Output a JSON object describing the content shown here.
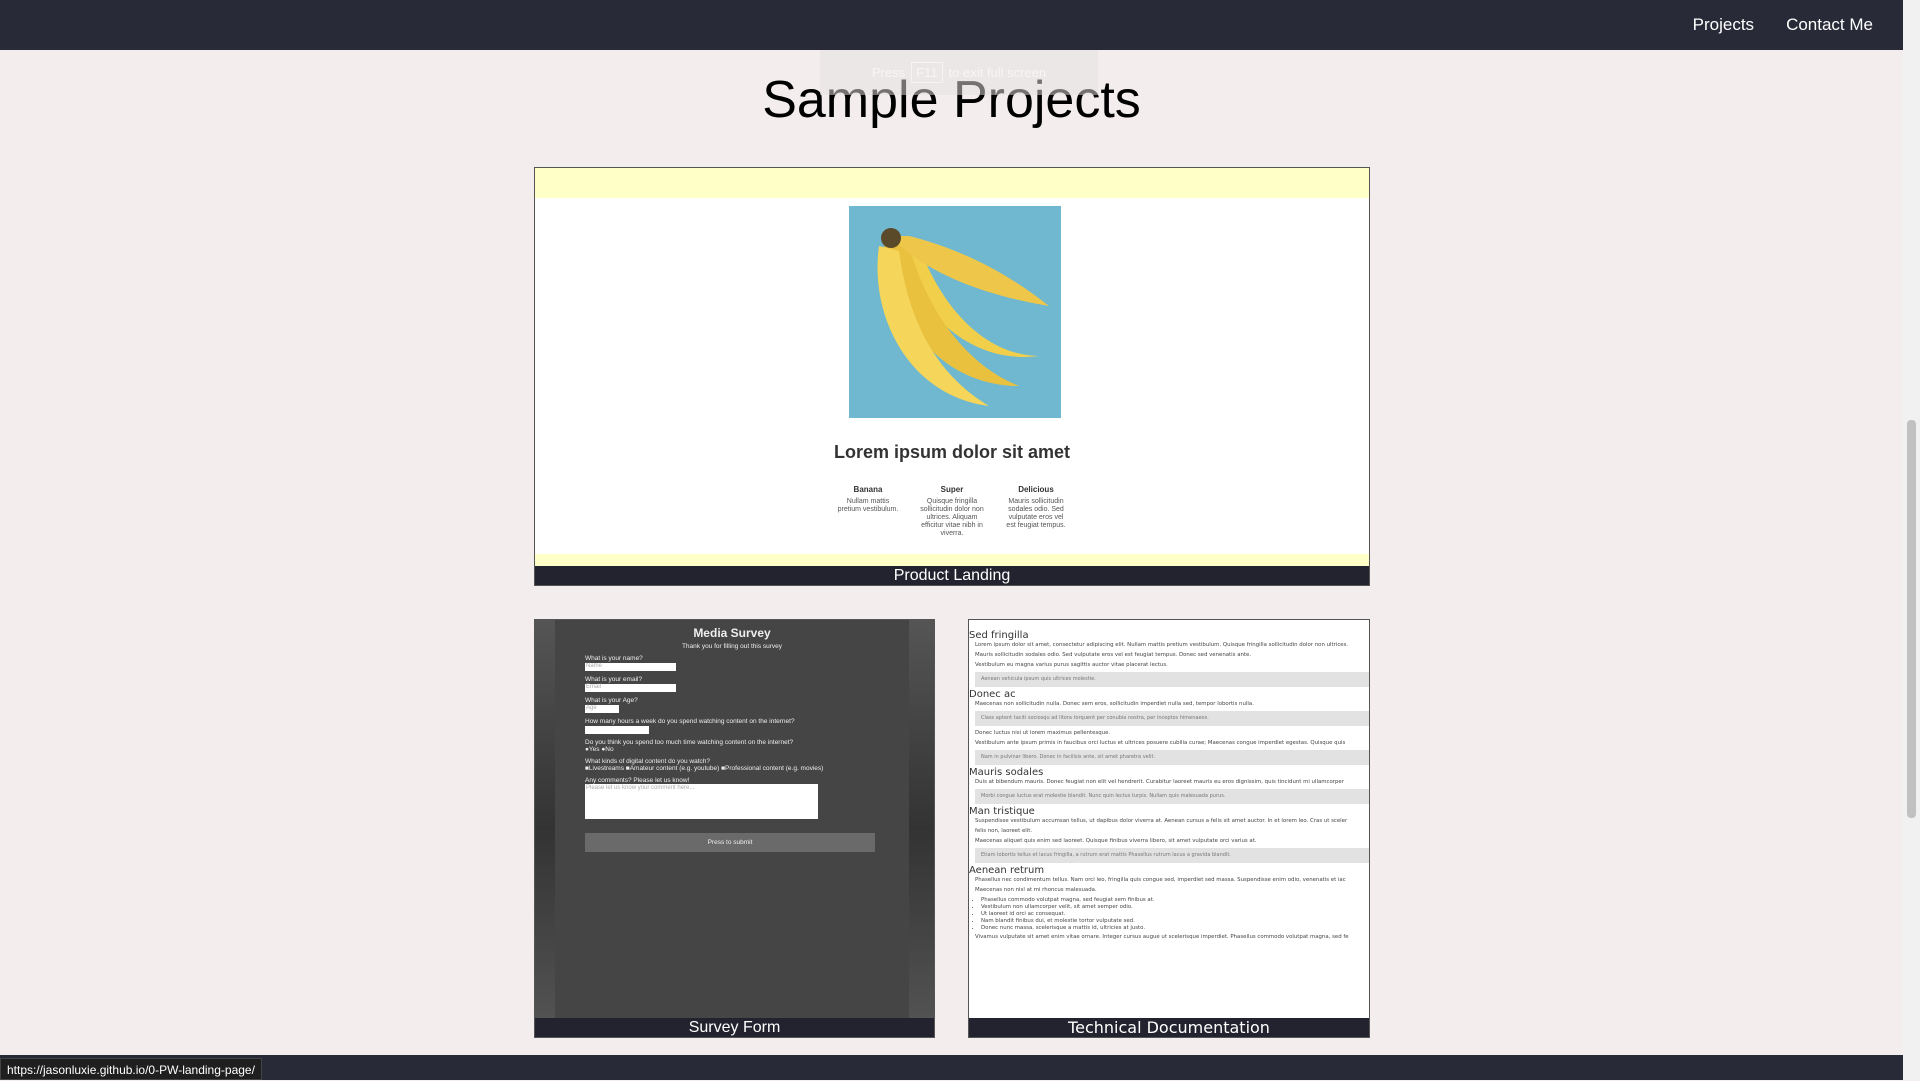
{
  "nav": {
    "links": [
      "Projects",
      "Contact Me"
    ]
  },
  "toast": {
    "pre": "Press",
    "key": "F11",
    "post": "to exit full screen"
  },
  "title": "Sample Projects",
  "product": {
    "heading": "Lorem ipsum dolor sit amet",
    "features": [
      {
        "title": "Banana",
        "text": "Nullam mattis pretium vestibulum."
      },
      {
        "title": "Super",
        "text": "Quisque fringilla sollicitudin dolor non ultrices. Aliquam efficitur vitae nibh in viverra."
      },
      {
        "title": "Delicious",
        "text": "Mauris sollicitudin sodales odio. Sed vulputate eros vel est feugiat tempus."
      }
    ],
    "caption": "Product Landing"
  },
  "survey": {
    "title": "Media Survey",
    "subtitle": "Thank you for filling out this survey",
    "q1": "What is your name?",
    "p1": "Name",
    "q2": "What is your email?",
    "p2": "Email",
    "q3": "What is your Age?",
    "p3": "Age",
    "q4": "How many hours a week do you spend watching content on the internet?",
    "q5": "Do you think you spend too much time watching content on the internet?",
    "r5": "●Yes ●No",
    "q6": "What kinds of digital content do you watch?",
    "r6": "■Livestreams ■Amateur content (e.g. youtube) ■Professional content (e.g. movies)",
    "q7": "Any comments? Please let us know!",
    "p7": "Please let us know your comment here...",
    "submit": "Press to submit",
    "caption": "Survey Form"
  },
  "techdoc": {
    "caption": "Technical Documentation",
    "sections": [
      {
        "h": "Sed fringilla",
        "p": [
          "Lorem ipsum dolor sit amet, consectetur adipiscing elit. Nullam mattis pretium vestibulum. Quisque fringilla sollicitudin dolor non ultrices.",
          "Mauris sollicitudin sodales odio. Sed vulputate eros vel est feugiat tempus. Donec sed venenatis ante.",
          "Vestibulum eu magna varius purus sagittis auctor vitae placerat lectus."
        ],
        "code": "Aenean vehicula ipsum quis ultrices molestie."
      },
      {
        "h": "Donec ac",
        "p": [
          "Maecenas non sollicitudin nulla. Donec sem eros, sollicitudin imperdiet nulla sed, tempor lobortis nulla."
        ],
        "code": "Class aptent taciti sociosqu ad litora torquent per conubia nostra, per inceptos himenaeos.",
        "p2": [
          "Donec luctus nisi ut lorem maximus pellentesque.",
          "Vestibulum ante ipsum primis in faucibus orci luctus et ultrices posuere cubilia curae; Maecenas congue imperdiet egestas. Quisque quis"
        ],
        "code2": "Nam in pulvinar libero. Donec in facilisis ante, sit amet pharetra velit."
      },
      {
        "h": "Mauris sodales",
        "p": [
          "Duis at bibendum mauris. Donec feugiat non elit vel hendrerit. Curabitur laoreet mauris eu eros dignissim, quis tincidunt mi ullamcorper"
        ],
        "code": "Morbi congue luctus erat molestie blandit. Nunc quin lectus turpis. Nullam quis malesuada purus."
      },
      {
        "h": "Man tristique",
        "p": [
          "Suspendisse vestibulum accumsan tellus, ut dapibus dolor viverra at. Aenean cursus a felis sit amet auctor. In et lorem leo. Cras ut sceler",
          "felis non, laoreet elit.",
          "Maecenas aliquet quis enim sed laoreet. Quisque finibus viverra libero, sit amet vulputate orci varius at."
        ],
        "code": "Etiam lobortis tellus et lacus fringilla, a rutrum erat mattis Phasellus rutrum lacus a gravida blandit."
      },
      {
        "h": "Aenean retrum",
        "p": [
          "Phasellus nec condimentum tellus. Nam orci leo, fringilla quis congue sed, imperdiet sed massa. Suspendisse enim odio, venenatis et iac",
          "Maecenas non nisl at mi rhoncus malesuada."
        ],
        "list": [
          "Phasellus commodo volutpat magna, sed feugiat sem finibus at.",
          "Vestibulum non ullamcorper velit, sit amet semper odio.",
          "Ut laoreet id orci ac consequat.",
          "Nam blandit finibus dui, et molestie tortor vulputate sed.",
          "Donec nunc massa, scelerisque a mattis id, ultricies at justo."
        ],
        "p2": [
          "Vivamus vulputate sit amet enim vitae ornare. Integer cursus augue ut scelerisque imperdiet. Phasellus commodo volutpat magna, sed fe"
        ]
      }
    ]
  },
  "status_url": "https://jasonluxie.github.io/0-PW-landing-page/"
}
